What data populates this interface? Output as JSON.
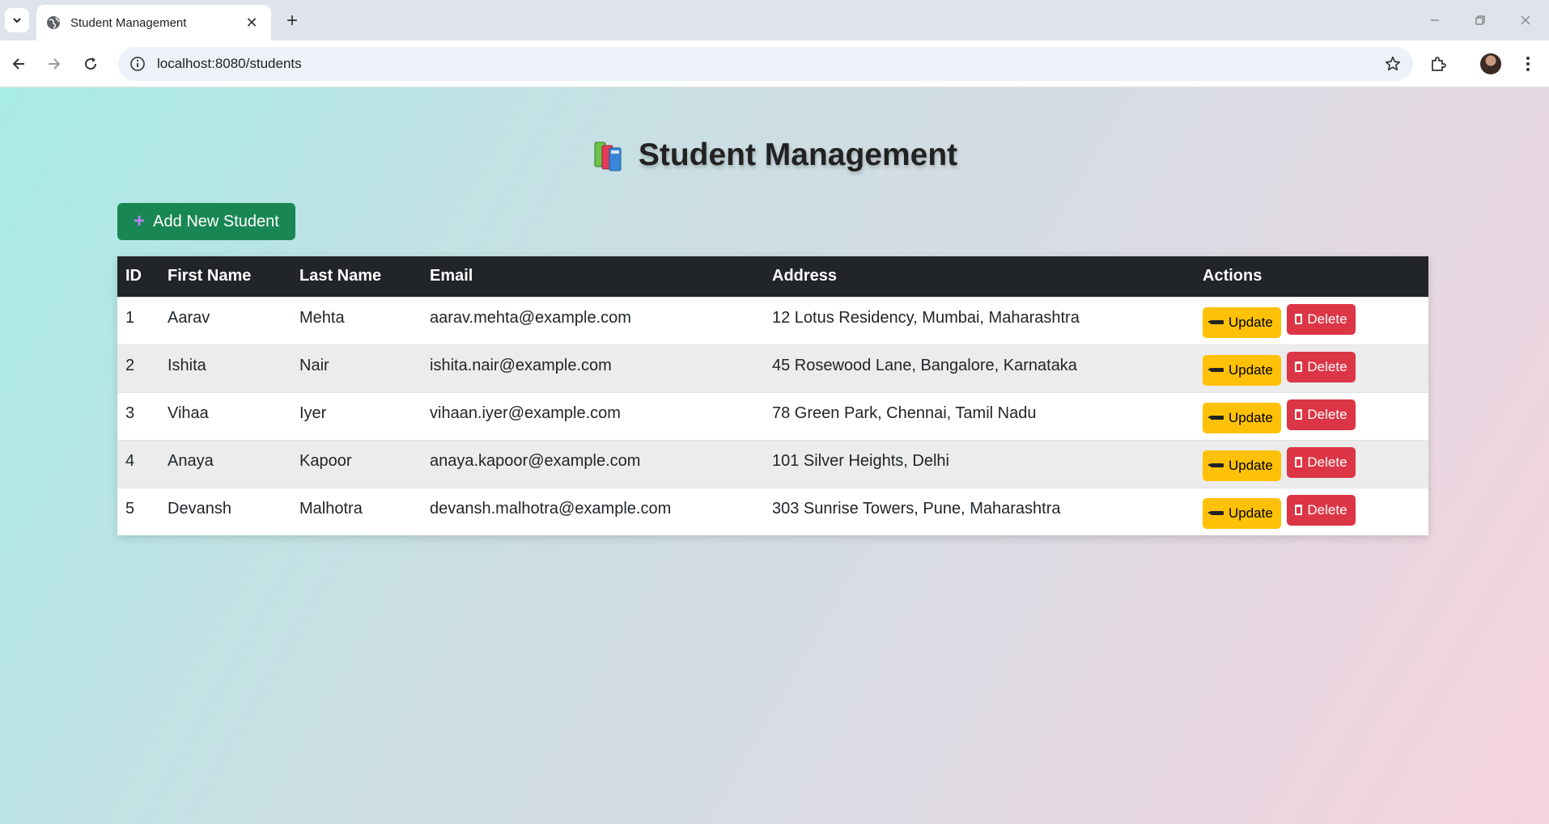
{
  "browser": {
    "tab_title": "Student Management",
    "url": "localhost:8080/students"
  },
  "page": {
    "title": "Student Management",
    "add_button": "Add New Student"
  },
  "table": {
    "headers": [
      "ID",
      "First Name",
      "Last Name",
      "Email",
      "Address",
      "Actions"
    ],
    "rows": [
      {
        "id": "1",
        "first": "Aarav",
        "last": "Mehta",
        "email": "aarav.mehta@example.com",
        "address": "12 Lotus Residency, Mumbai, Maharashtra"
      },
      {
        "id": "2",
        "first": "Ishita",
        "last": "Nair",
        "email": "ishita.nair@example.com",
        "address": "45 Rosewood Lane, Bangalore, Karnataka"
      },
      {
        "id": "3",
        "first": "Vihaa",
        "last": "Iyer",
        "email": "vihaan.iyer@example.com",
        "address": "78 Green Park, Chennai, Tamil Nadu"
      },
      {
        "id": "4",
        "first": "Anaya",
        "last": "Kapoor",
        "email": "anaya.kapoor@example.com",
        "address": "101 Silver Heights, Delhi"
      },
      {
        "id": "5",
        "first": "Devansh",
        "last": "Malhotra",
        "email": "devansh.malhotra@example.com",
        "address": "303 Sunrise Towers, Pune, Maharashtra"
      }
    ],
    "update_label": "Update",
    "delete_label": "Delete"
  },
  "colors": {
    "add_button": "#198754",
    "update_button": "#ffc107",
    "delete_button": "#dc3545",
    "table_header": "#212529"
  }
}
